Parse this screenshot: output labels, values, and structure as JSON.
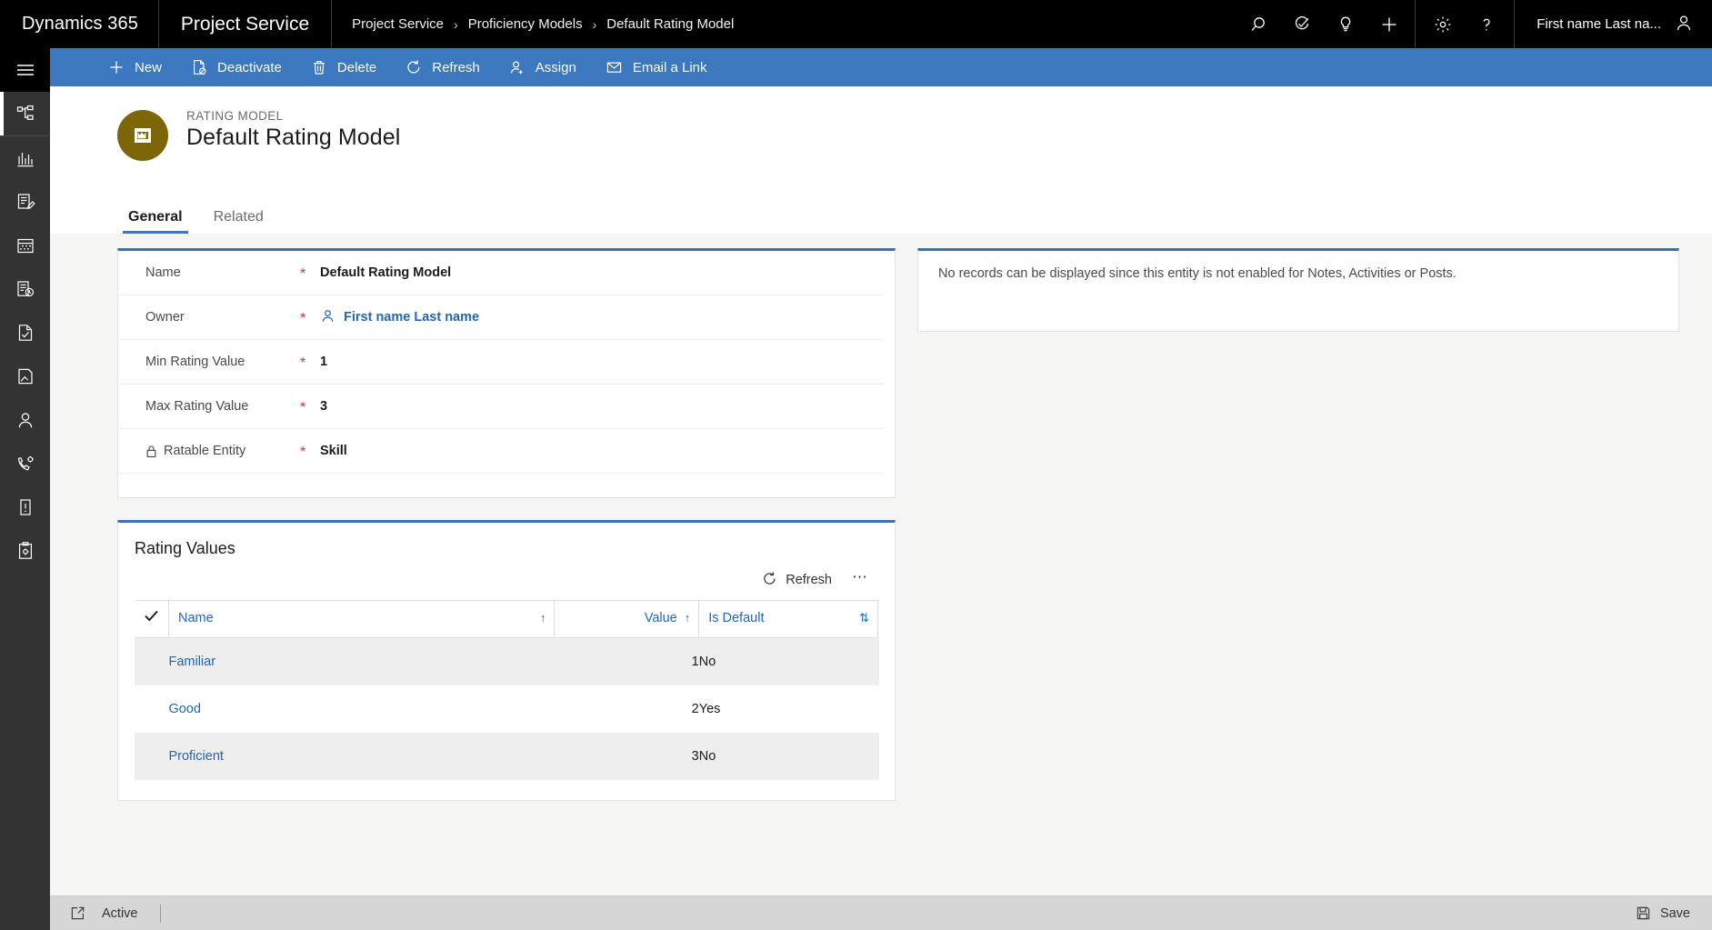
{
  "topnav": {
    "brand": "Dynamics 365",
    "app_name": "Project Service",
    "breadcrumbs": [
      "Project Service",
      "Proficiency Models",
      "Default Rating Model"
    ],
    "separator": "›",
    "icons": [
      "search-icon",
      "diagnostics-icon",
      "lightbulb-icon",
      "plus-icon",
      "gear-icon",
      "help-icon"
    ],
    "user_name": "First name Last na...",
    "bg_color": "#000000"
  },
  "rail": {
    "menu_label": "hamburger-menu",
    "items": [
      {
        "name": "sitemap-icon",
        "label": "Sitemap",
        "active": true
      },
      {
        "name": "dashboard-icon",
        "label": "Dashboards",
        "active": false
      },
      {
        "name": "notes-edit-icon",
        "label": "Notes",
        "active": false
      },
      {
        "name": "calendar-icon",
        "label": "Calendar",
        "active": false
      },
      {
        "name": "time-entries-icon",
        "label": "Time Entries",
        "active": false
      },
      {
        "name": "document-check-icon",
        "label": "Approvals",
        "active": false
      },
      {
        "name": "projects-icon",
        "label": "Projects",
        "active": false
      },
      {
        "name": "resource-icon",
        "label": "Resources",
        "active": false
      },
      {
        "name": "service-settings-icon",
        "label": "Service Configuration",
        "active": false
      },
      {
        "name": "alert-document-icon",
        "label": "Alerts",
        "active": false
      },
      {
        "name": "clipboard-settings-icon",
        "label": "Settings",
        "active": false
      }
    ]
  },
  "commandbar": {
    "bg_color": "#3b78c0",
    "buttons": [
      {
        "icon": "plus-icon",
        "label": "New"
      },
      {
        "icon": "deactivate-icon",
        "label": "Deactivate"
      },
      {
        "icon": "trash-icon",
        "label": "Delete"
      },
      {
        "icon": "refresh-icon",
        "label": "Refresh"
      },
      {
        "icon": "assign-icon",
        "label": "Assign"
      },
      {
        "icon": "email-link-icon",
        "label": "Email a Link"
      }
    ]
  },
  "record_header": {
    "entity_label": "RATING MODEL",
    "title": "Default Rating Model",
    "avatar_color": "#7d6608",
    "avatar_icon": "rating-model-icon"
  },
  "tabs": [
    {
      "label": "General",
      "active": true
    },
    {
      "label": "Related",
      "active": false
    }
  ],
  "form": {
    "accent_color": "#3b72b3",
    "required_marker": "*",
    "fields": [
      {
        "label": "Name",
        "required": true,
        "value": "Default Rating Model",
        "type": "text",
        "locked": false
      },
      {
        "label": "Owner",
        "required": true,
        "value": "First name Last name",
        "type": "lookup",
        "icon": "person-icon",
        "locked": false
      },
      {
        "label": "Min Rating Value",
        "required": true,
        "value": "1",
        "type": "number",
        "locked": false
      },
      {
        "label": "Max Rating Value",
        "required": true,
        "value": "3",
        "type": "number",
        "locked": false
      },
      {
        "label": "Ratable Entity",
        "required": true,
        "value": "Skill",
        "type": "text",
        "locked": true,
        "lock_icon": "lock-icon"
      }
    ]
  },
  "notes_panel": {
    "message": "No records can be displayed since this entity is not enabled for Notes, Activities or Posts."
  },
  "subgrid": {
    "title": "Rating Values",
    "toolbar": {
      "refresh_icon": "refresh-icon",
      "refresh_label": "Refresh",
      "overflow_label": "⋯"
    },
    "select_all_icon": "checkmark-icon",
    "columns": [
      {
        "label": "Name",
        "sort": "↑",
        "align": "left"
      },
      {
        "label": "Value",
        "sort": "↑",
        "align": "right"
      },
      {
        "label": "Is Default",
        "sort": "⇅",
        "align": "left"
      }
    ],
    "rows": [
      {
        "name": "Familiar",
        "value": "1",
        "is_default": "No"
      },
      {
        "name": "Good",
        "value": "2",
        "is_default": "Yes"
      },
      {
        "name": "Proficient",
        "value": "3",
        "is_default": "No"
      }
    ]
  },
  "footer": {
    "popout_icon": "popout-icon",
    "status": "Active",
    "save_icon": "save-icon",
    "save_label": "Save"
  }
}
